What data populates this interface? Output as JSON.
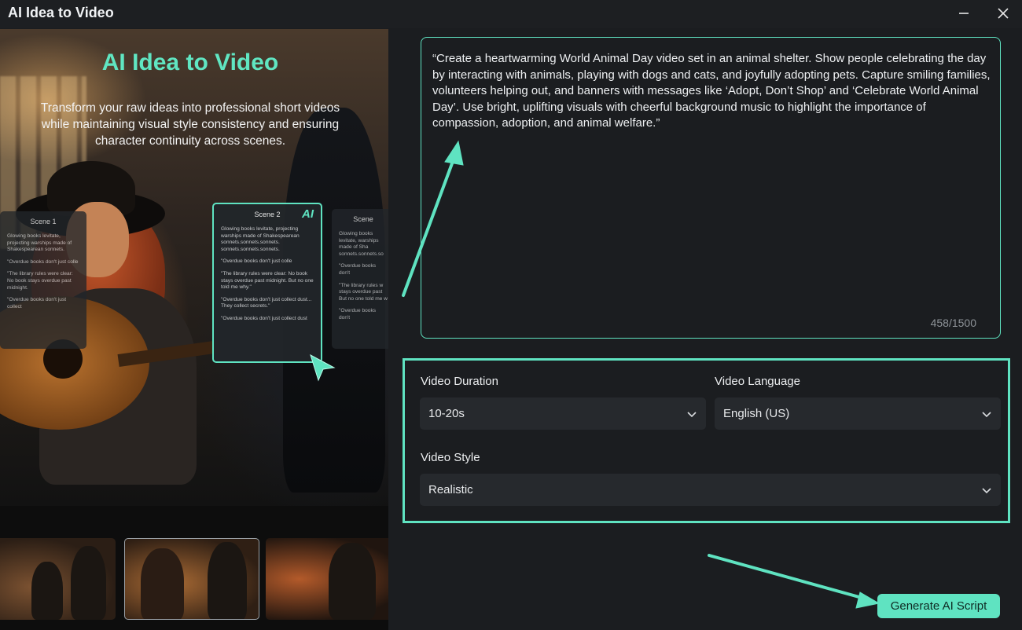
{
  "window": {
    "title": "AI Idea to Video",
    "minimize_icon": "minimize-icon",
    "close_icon": "close-icon"
  },
  "hero": {
    "title": "AI Idea to Video",
    "subtitle": "Transform your raw ideas into professional short videos while maintaining visual style consistency and ensuring character continuity across scenes.",
    "scenes": [
      {
        "header": "Scene 1",
        "lines": [
          "Glowing books levitate, projecting warships made of Shakespearean sonnets.",
          "\"Overdue books don't just colle",
          "\"The library rules were clear: No book stays overdue past midnight.",
          "\"Overdue books don't just collect"
        ]
      },
      {
        "header": "Scene 2",
        "badge": "AI",
        "lines": [
          "Glowing books levitate, projecting warships made of Shakespearean sonnets.sonnets.sonnets. sonnets.sonnets.sonnets.",
          "\"Overdue books don't just colle",
          "\"The library rules were clear: No book stays overdue past midnight. But no one told me why.\"",
          "\"Overdue books don't just collect dust... They collect secrets.\"",
          "\"Overdue books don't just collect dust"
        ]
      },
      {
        "header": "Scene",
        "lines": [
          "Glowing books levitate, warships made of Sha sonnets.sonnets.so",
          "\"Overdue books don't",
          "\"The library rules w stays overdue past But no one told me w",
          "\"Overdue books don't"
        ]
      }
    ]
  },
  "prompt": {
    "text": "“Create a heartwarming World Animal Day video set in an animal shelter. Show people celebrating the day by interacting with animals, playing with dogs and cats, and joyfully adopting pets. Capture smiling families, volunteers helping out, and banners with messages like ‘Adopt, Don’t Shop’ and ‘Celebrate World Animal Day’. Use bright, uplifting visuals with cheerful background music to highlight the importance of compassion, adoption, and animal welfare.”",
    "char_count": "458/1500"
  },
  "settings": {
    "duration_label": "Video Duration",
    "duration_value": "10-20s",
    "language_label": "Video Language",
    "language_value": "English (US)",
    "style_label": "Video Style",
    "style_value": "Realistic"
  },
  "actions": {
    "generate_label": "Generate AI Script"
  },
  "colors": {
    "accent": "#5fe3c1",
    "background": "#1b1d20",
    "field": "#26292d"
  }
}
